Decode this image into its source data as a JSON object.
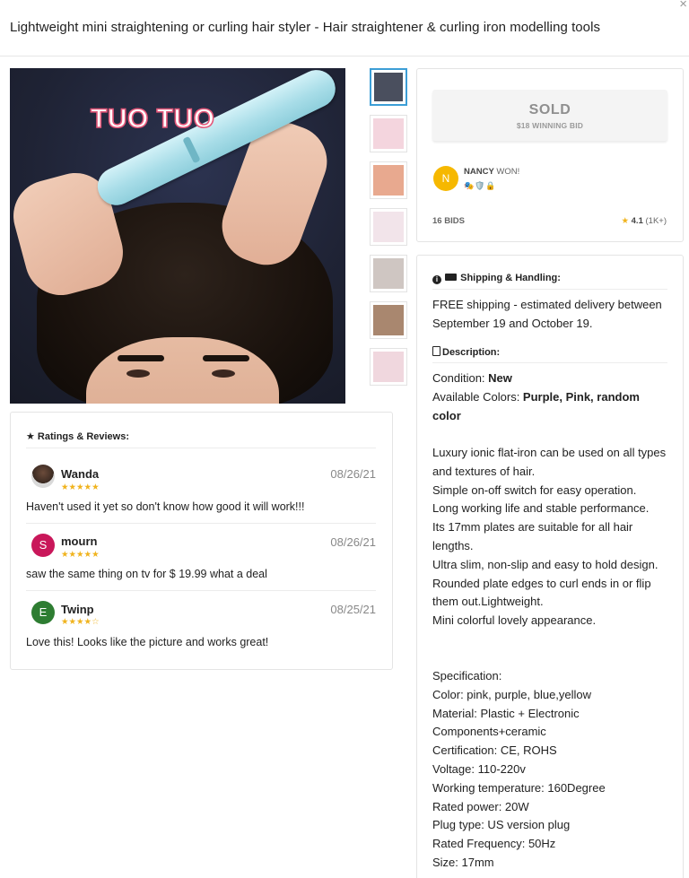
{
  "close_glyph": "×",
  "title": "Lightweight mini straightening or curling hair styler - Hair straightener & curling iron modelling tools",
  "image": {
    "overlay_text": "TUO TUO"
  },
  "thumbnails": [
    {
      "name": "thumb-1",
      "bg": "#4a4f5e"
    },
    {
      "name": "thumb-2",
      "bg": "#f4d5de"
    },
    {
      "name": "thumb-3",
      "bg": "#e8a98f"
    },
    {
      "name": "thumb-4",
      "bg": "#f2e4ea"
    },
    {
      "name": "thumb-5",
      "bg": "#cfc6c2"
    },
    {
      "name": "thumb-6",
      "bg": "#a9876f"
    },
    {
      "name": "thumb-7",
      "bg": "#f0d7de"
    }
  ],
  "auction": {
    "status": "SOLD",
    "winning_bid": "$18 WINNING BID",
    "winner_initial": "N",
    "winner_name": "NANCY",
    "winner_suffix": " WON!",
    "badges": "🎭🛡️🔒",
    "bids": "16 BIDS",
    "rating": "4.1",
    "rating_count": " (1K+)"
  },
  "shipping": {
    "heading": "Shipping & Handling:",
    "text": "FREE shipping - estimated delivery between September 19 and October 19."
  },
  "description": {
    "heading": "Description:",
    "condition_label": "Condition: ",
    "condition_value": "New",
    "colors_label": "Available Colors: ",
    "colors_value": "Purple, Pink, random color",
    "body": "Luxury ionic flat-iron can be used on all types and textures of hair.\nSimple on-off switch for easy operation.\nLong working life and stable performance.\nIts 17mm plates are suitable for all hair lengths.\nUltra slim, non-slip and easy to hold design.\nRounded plate edges to curl ends in or flip them out.Lightweight.\nMini colorful lovely appearance.",
    "spec": "Specification:\nColor: pink, purple, blue,yellow\nMaterial: Plastic + Electronic Components+ceramic\nCertification: CE, ROHS\nVoltage: 110-220v\nWorking temperature: 160Degree\nRated power: 20W\nPlug type: US version plug\nRated Frequency: 50Hz\nSize: 17mm"
  },
  "reviews": {
    "heading": "Ratings & Reviews:",
    "items": [
      {
        "name": "Wanda",
        "initial": "",
        "stars": "★★★★★",
        "date": "08/26/21",
        "text": "Haven't used it yet so don't know how good it will work!!!"
      },
      {
        "name": "mourn",
        "initial": "S",
        "stars": "★★★★★",
        "date": "08/26/21",
        "text": "saw the same thing on tv for $ 19.99 what a deal"
      },
      {
        "name": "Twinp",
        "initial": "E",
        "stars": "★★★★☆",
        "date": "08/25/21",
        "text": "Love this! Looks like the picture and works great!"
      }
    ]
  },
  "colors": {
    "accent_blue": "#3c9ed6",
    "star_yellow": "#f0b31d",
    "winner_avatar": "#f6b800",
    "reviewer_s": "#c9175a",
    "reviewer_e": "#2e7d32"
  }
}
